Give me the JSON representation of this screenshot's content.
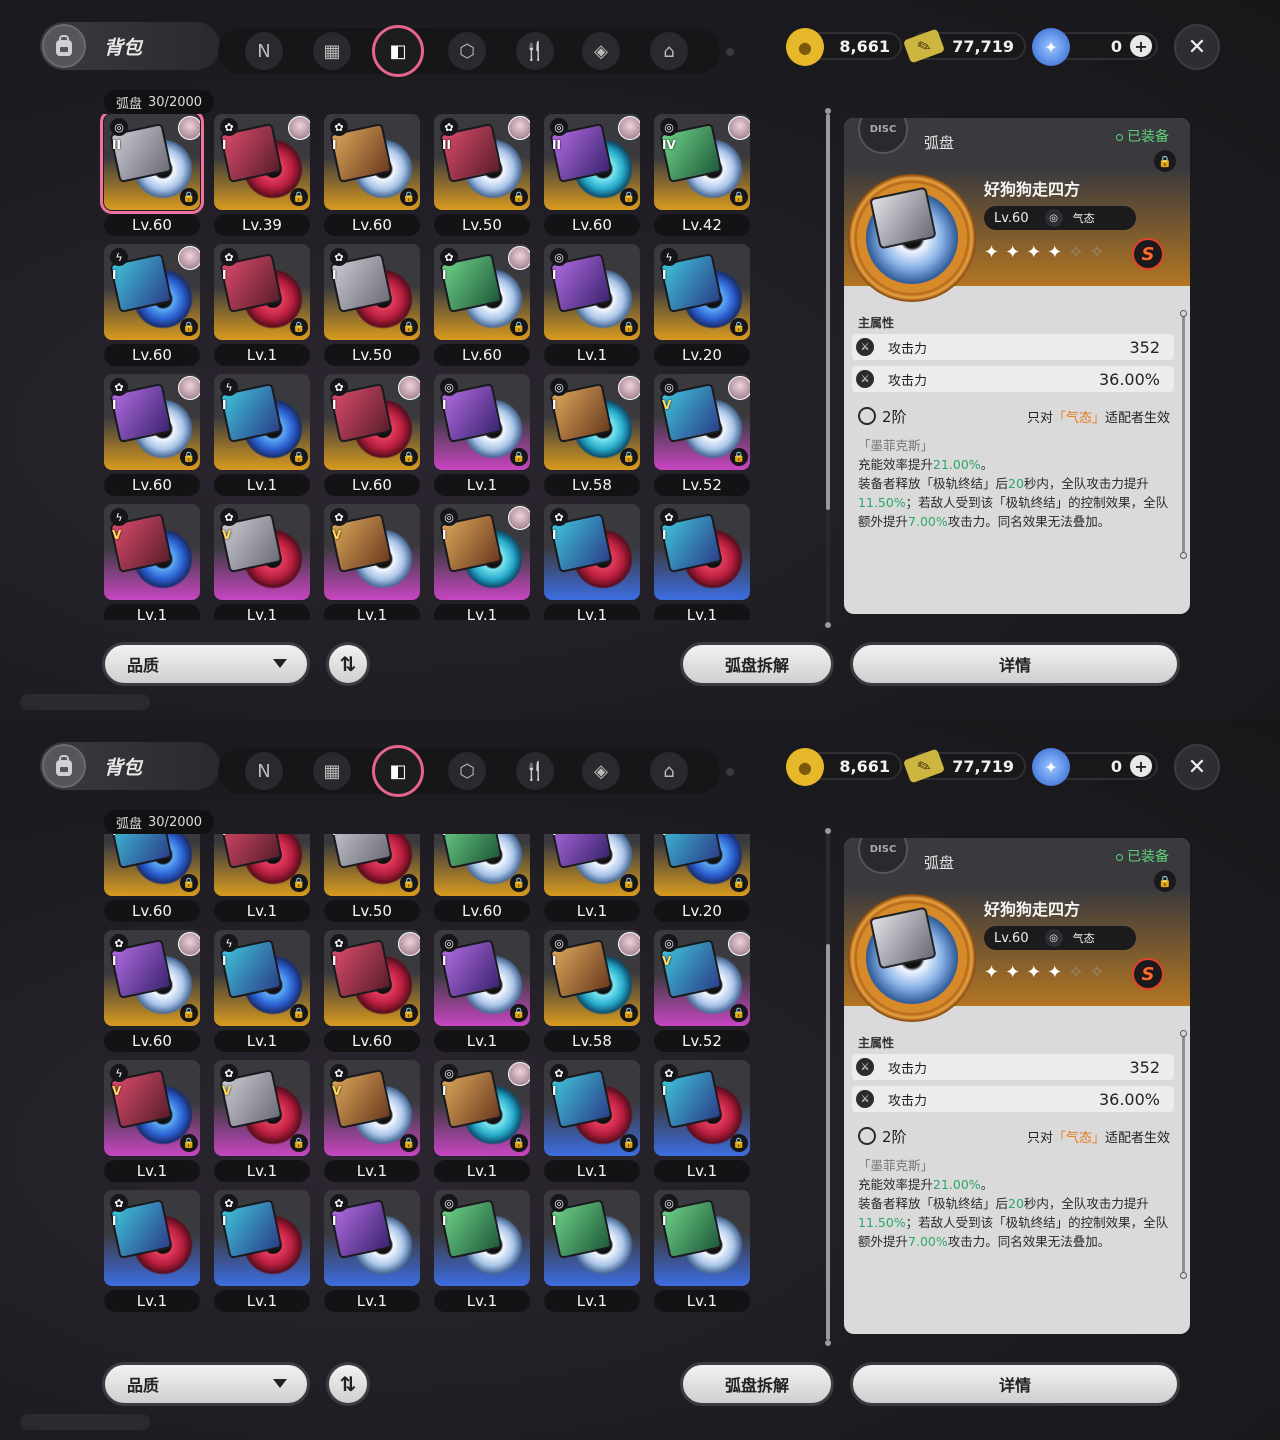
{
  "header": {
    "bag_title": "背包",
    "tabs": [
      {
        "name": "tab-agents",
        "glyph": "N"
      },
      {
        "name": "tab-bangboo",
        "glyph": "▦"
      },
      {
        "name": "tab-drive-disc",
        "glyph": "◧",
        "active": true
      },
      {
        "name": "tab-materials",
        "glyph": "⬡"
      },
      {
        "name": "tab-food",
        "glyph": "🍴"
      },
      {
        "name": "tab-items",
        "glyph": "◈"
      },
      {
        "name": "tab-home",
        "glyph": "⌂"
      }
    ],
    "currencies": [
      {
        "name": "denny",
        "value": "8,661",
        "color": "#e6b82a",
        "glyph": "●"
      },
      {
        "name": "ticket",
        "value": "77,719",
        "color": "#d8c14a",
        "glyph": "✎"
      },
      {
        "name": "polychrome",
        "value": "0",
        "color": "#3d7be6",
        "glyph": "✦",
        "has_plus": true
      }
    ],
    "close_glyph": "✕"
  },
  "inventory": {
    "category": "弧盘",
    "count": "30/2000"
  },
  "grid_items": [
    {
      "slot": "II",
      "level": "Lv.60",
      "rarity": "S",
      "disc": "white",
      "art": "a1",
      "attr": "◎",
      "avatar": true,
      "selected": true
    },
    {
      "slot": "I",
      "level": "Lv.39",
      "rarity": "S",
      "disc": "red",
      "art": "a2",
      "attr": "✿",
      "avatar": true
    },
    {
      "slot": "I",
      "level": "Lv.60",
      "rarity": "S",
      "disc": "white",
      "art": "a5",
      "attr": "✿",
      "avatar": false
    },
    {
      "slot": "II",
      "level": "Lv.50",
      "rarity": "S",
      "disc": "white",
      "art": "a2",
      "attr": "✿",
      "avatar": true
    },
    {
      "slot": "II",
      "level": "Lv.60",
      "rarity": "S",
      "disc": "cyan",
      "art": "a4",
      "attr": "◎",
      "avatar": true
    },
    {
      "slot": "IV",
      "level": "Lv.42",
      "rarity": "S",
      "disc": "white",
      "art": "a6",
      "attr": "◎",
      "avatar": true
    },
    {
      "slot": "I",
      "level": "Lv.60",
      "rarity": "S",
      "disc": "blue",
      "art": "a3",
      "attr": "ϟ",
      "avatar": true
    },
    {
      "slot": "I",
      "level": "Lv.1",
      "rarity": "S",
      "disc": "red",
      "art": "a2",
      "attr": "✿",
      "avatar": false
    },
    {
      "slot": "I",
      "level": "Lv.50",
      "rarity": "S",
      "disc": "red",
      "art": "a1",
      "attr": "✿",
      "avatar": false
    },
    {
      "slot": "I",
      "level": "Lv.60",
      "rarity": "S",
      "disc": "white",
      "art": "a6",
      "attr": "✿",
      "avatar": true
    },
    {
      "slot": "I",
      "level": "Lv.1",
      "rarity": "S",
      "disc": "white",
      "art": "a4",
      "attr": "◎",
      "avatar": false
    },
    {
      "slot": "I",
      "level": "Lv.20",
      "rarity": "S",
      "disc": "blue",
      "art": "a3",
      "attr": "ϟ",
      "avatar": false
    },
    {
      "slot": "I",
      "level": "Lv.60",
      "rarity": "S",
      "disc": "white",
      "art": "a4",
      "attr": "✿",
      "avatar": true
    },
    {
      "slot": "I",
      "level": "Lv.1",
      "rarity": "S",
      "disc": "blue",
      "art": "a3",
      "attr": "ϟ",
      "avatar": false
    },
    {
      "slot": "I",
      "level": "Lv.60",
      "rarity": "S",
      "disc": "red",
      "art": "a2",
      "attr": "✿",
      "avatar": true
    },
    {
      "slot": "I",
      "level": "Lv.1",
      "rarity": "A",
      "disc": "white",
      "art": "a4",
      "attr": "◎",
      "avatar": false
    },
    {
      "slot": "I",
      "level": "Lv.58",
      "rarity": "S",
      "disc": "cyan",
      "art": "a5",
      "attr": "◎",
      "avatar": true
    },
    {
      "slot": "V",
      "level": "Lv.52",
      "rarity": "A",
      "disc": "white",
      "art": "a3",
      "attr": "◎",
      "avatar": true
    },
    {
      "slot": "V",
      "level": "Lv.1",
      "rarity": "A",
      "disc": "blue",
      "art": "a2",
      "attr": "ϟ",
      "avatar": false
    },
    {
      "slot": "V",
      "level": "Lv.1",
      "rarity": "A",
      "disc": "red",
      "art": "a1",
      "attr": "✿",
      "avatar": false
    },
    {
      "slot": "V",
      "level": "Lv.1",
      "rarity": "A",
      "disc": "white",
      "art": "a5",
      "attr": "✿",
      "avatar": false
    },
    {
      "slot": "I",
      "level": "Lv.1",
      "rarity": "A",
      "disc": "cyan",
      "art": "a5",
      "attr": "◎",
      "avatar": true
    },
    {
      "slot": "I",
      "level": "Lv.1",
      "rarity": "B",
      "disc": "red",
      "art": "a3",
      "attr": "✿",
      "avatar": false
    },
    {
      "slot": "I",
      "level": "Lv.1",
      "rarity": "B",
      "disc": "red",
      "art": "a3",
      "attr": "✿",
      "avatar": false
    },
    {
      "slot": "I",
      "level": "Lv.1",
      "rarity": "B",
      "disc": "red",
      "art": "a3",
      "attr": "✿",
      "avatar": false
    },
    {
      "slot": "I",
      "level": "Lv.1",
      "rarity": "B",
      "disc": "red",
      "art": "a3",
      "attr": "✿",
      "avatar": false
    },
    {
      "slot": "I",
      "level": "Lv.1",
      "rarity": "B",
      "disc": "white",
      "art": "a4",
      "attr": "✿",
      "avatar": false
    },
    {
      "slot": "I",
      "level": "Lv.1",
      "rarity": "B",
      "disc": "white",
      "art": "a6",
      "attr": "◎",
      "avatar": false
    },
    {
      "slot": "I",
      "level": "Lv.1",
      "rarity": "B",
      "disc": "white",
      "art": "a6",
      "attr": "◎",
      "avatar": false
    },
    {
      "slot": "I",
      "level": "Lv.1",
      "rarity": "B",
      "disc": "white",
      "art": "a6",
      "attr": "◎",
      "avatar": false
    }
  ],
  "views": [
    {
      "name": "view-top",
      "start_row": 0,
      "lock_hidden_last_row": true
    },
    {
      "name": "view-scrolled",
      "start_row": 1
    }
  ],
  "detail": {
    "type_label": "弧盘",
    "equipped_label": "已装备",
    "item_name": "好狗狗走四方",
    "level": "Lv.60",
    "attribute": "气态",
    "stars_total": 6,
    "stars_filled": 4,
    "rank": "S",
    "badge_text": "DISC",
    "main_attr_title": "主属性",
    "stats": [
      {
        "label": "攻击力",
        "value": "352"
      },
      {
        "label": "攻击力",
        "value": "36.00%"
      }
    ],
    "set_tier": "2阶",
    "set_condition_prefix": "只对",
    "set_condition_highlight": "「气态」",
    "set_condition_suffix": "适配者生效",
    "set_name": "「墨菲克斯」",
    "effect_line1_a": "充能效率提升",
    "effect_line1_b": "21.00%",
    "effect_line1_c": "。",
    "effect_a": "装备者释放「极轨终结」后",
    "effect_b": "20",
    "effect_c": "秒内，全队攻击力提升",
    "effect_d": "11.50%",
    "effect_e": "；若敌人受到该「极轨终结」的控制效果，全队额外提升",
    "effect_f": "7.00%",
    "effect_g": "攻击力。同名效果无法叠加。"
  },
  "buttons": {
    "quality": "品质",
    "sort_glyph": "⇅",
    "dismantle": "弧盘拆解",
    "details": "详情"
  }
}
